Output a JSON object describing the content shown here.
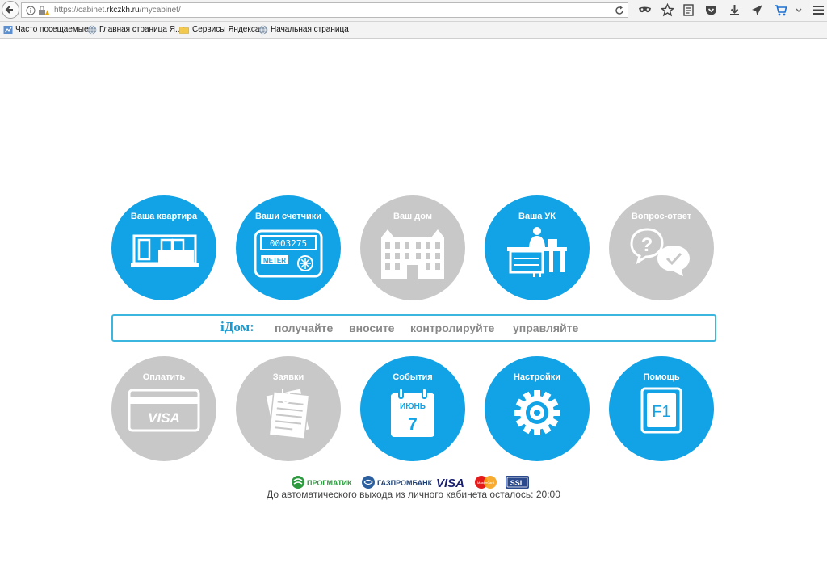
{
  "browser": {
    "url_prefix": "https://cabinet.",
    "url_host": "rkczkh.ru",
    "url_path": "/mycabinet/",
    "bookmarks": [
      {
        "label": "Часто посещаемые"
      },
      {
        "label": "Главная страница Я..."
      },
      {
        "label": "Сервисы Яндекса"
      },
      {
        "label": "Начальная страница"
      }
    ]
  },
  "tiles_top": [
    {
      "label": "Ваша квартира",
      "icon": "apartment-window-icon",
      "color": "blue"
    },
    {
      "label": "Ваши счетчики",
      "icon": "meter-icon",
      "color": "blue",
      "meter_digits": "0003275",
      "meter_brand": "METER"
    },
    {
      "label": "Ваш дом",
      "icon": "building-icon",
      "color": "gray"
    },
    {
      "label": "Ваша УК",
      "icon": "office-desk-icon",
      "color": "blue"
    },
    {
      "label": "Вопрос-ответ",
      "icon": "question-answer-icon",
      "color": "gray"
    }
  ],
  "slogan": {
    "brand": "iДом:",
    "words": [
      "получайте",
      "вносите",
      "контролируйте",
      "управляйте"
    ]
  },
  "tiles_bottom": [
    {
      "label": "Оплатить",
      "icon": "card-visa-icon",
      "color": "gray",
      "card_text": "VISA"
    },
    {
      "label": "Заявки",
      "icon": "documents-icon",
      "color": "gray"
    },
    {
      "label": "События",
      "icon": "calendar-icon",
      "color": "blue",
      "month": "ИЮНЬ",
      "day": "7"
    },
    {
      "label": "Настройки",
      "icon": "gear-icon",
      "color": "blue"
    },
    {
      "label": "Помощь",
      "icon": "f1-key-icon",
      "color": "blue",
      "key": "F1"
    }
  ],
  "partners": {
    "progmatic": "ПРОГМАТИК",
    "gazprombank": "ГАЗПРОМБАНК",
    "visa": "VISA",
    "mastercard": "MasterCard",
    "ssl": "SSL"
  },
  "timeout_text": "До автоматического выхода из личного кабинета осталось: 20:00",
  "colors": {
    "blue": "#12a3e6",
    "gray": "#c8c8c8",
    "accent": "#1b9ad1"
  }
}
